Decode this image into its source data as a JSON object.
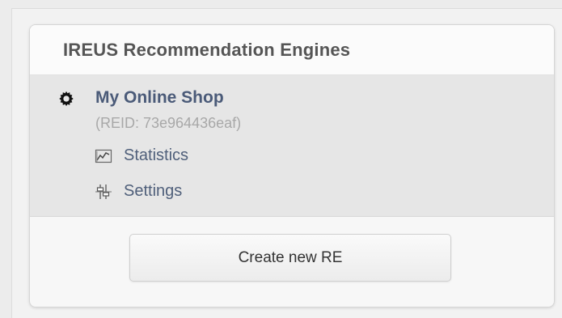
{
  "panel": {
    "title": "IREUS Recommendation Engines"
  },
  "engine": {
    "name": "My Online Shop",
    "reid": "(REID: 73e964436eaf)",
    "icon": "gear-icon",
    "menu": [
      {
        "label": "Statistics",
        "icon": "chart-icon"
      },
      {
        "label": "Settings",
        "icon": "settings-icon"
      }
    ]
  },
  "footer": {
    "create_label": "Create new RE"
  },
  "colors": {
    "link": "#4a5a78",
    "muted": "#a8a8a8",
    "section_bg": "#e6e6e6"
  }
}
